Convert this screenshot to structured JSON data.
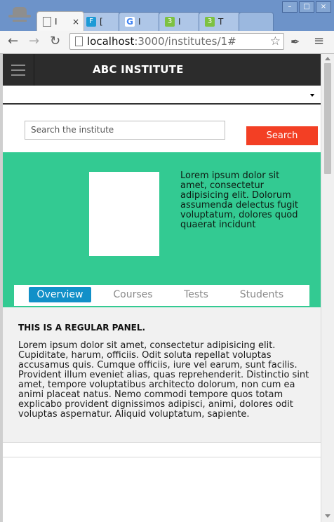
{
  "browser": {
    "tabs": [
      {
        "title": "I",
        "close": "×",
        "favicon_color": "#ffffff",
        "active": true
      },
      {
        "title": "[",
        "favicon_color": "#1c9ad6",
        "favicon_text": "F"
      },
      {
        "title": "I",
        "favicon_color": "#ffffff",
        "favicon_text": "G"
      },
      {
        "title": "I",
        "favicon_color": "#7dc142",
        "favicon_text": "3"
      },
      {
        "title": "T",
        "favicon_color": "#7dc142",
        "favicon_text": "3"
      }
    ],
    "url_host": "localhost",
    "url_path": ":3000/institutes/1#"
  },
  "app": {
    "brand": "ABC INSTITUTE",
    "search": {
      "placeholder": "Search the institute",
      "button_label": "Search"
    },
    "hero": {
      "description": "Lorem ipsum dolor sit amet, consectetur adipisicing elit. Dolorum assumenda delectus fugit voluptatum, dolores quod quaerat incidunt"
    },
    "tabs": [
      {
        "label": "Overview",
        "active": true
      },
      {
        "label": "Courses",
        "active": false
      },
      {
        "label": "Tests",
        "active": false
      },
      {
        "label": "Students",
        "active": false
      }
    ],
    "panel": {
      "heading": "THIS IS A REGULAR PANEL.",
      "body": "Lorem ipsum dolor sit amet, consectetur adipisicing elit. Cupiditate, harum, officiis. Odit soluta repellat voluptas accusamus quis. Cumque officiis, iure vel earum, sunt facilis. Provident illum eveniet alias, quas reprehenderit. Distinctio sint amet, tempore voluptatibus architecto dolorum, non cum ea animi placeat natus. Nemo commodi tempore quos totam explicabo provident dignissimos adipisci, animi, dolores odit voluptas aspernatur. Aliquid voluptatum, sapiente."
    }
  },
  "colors": {
    "hero_bg": "#33ca92",
    "search_button": "#f33f24",
    "active_tab": "#1290c8",
    "navbar": "#2c2c2c"
  }
}
